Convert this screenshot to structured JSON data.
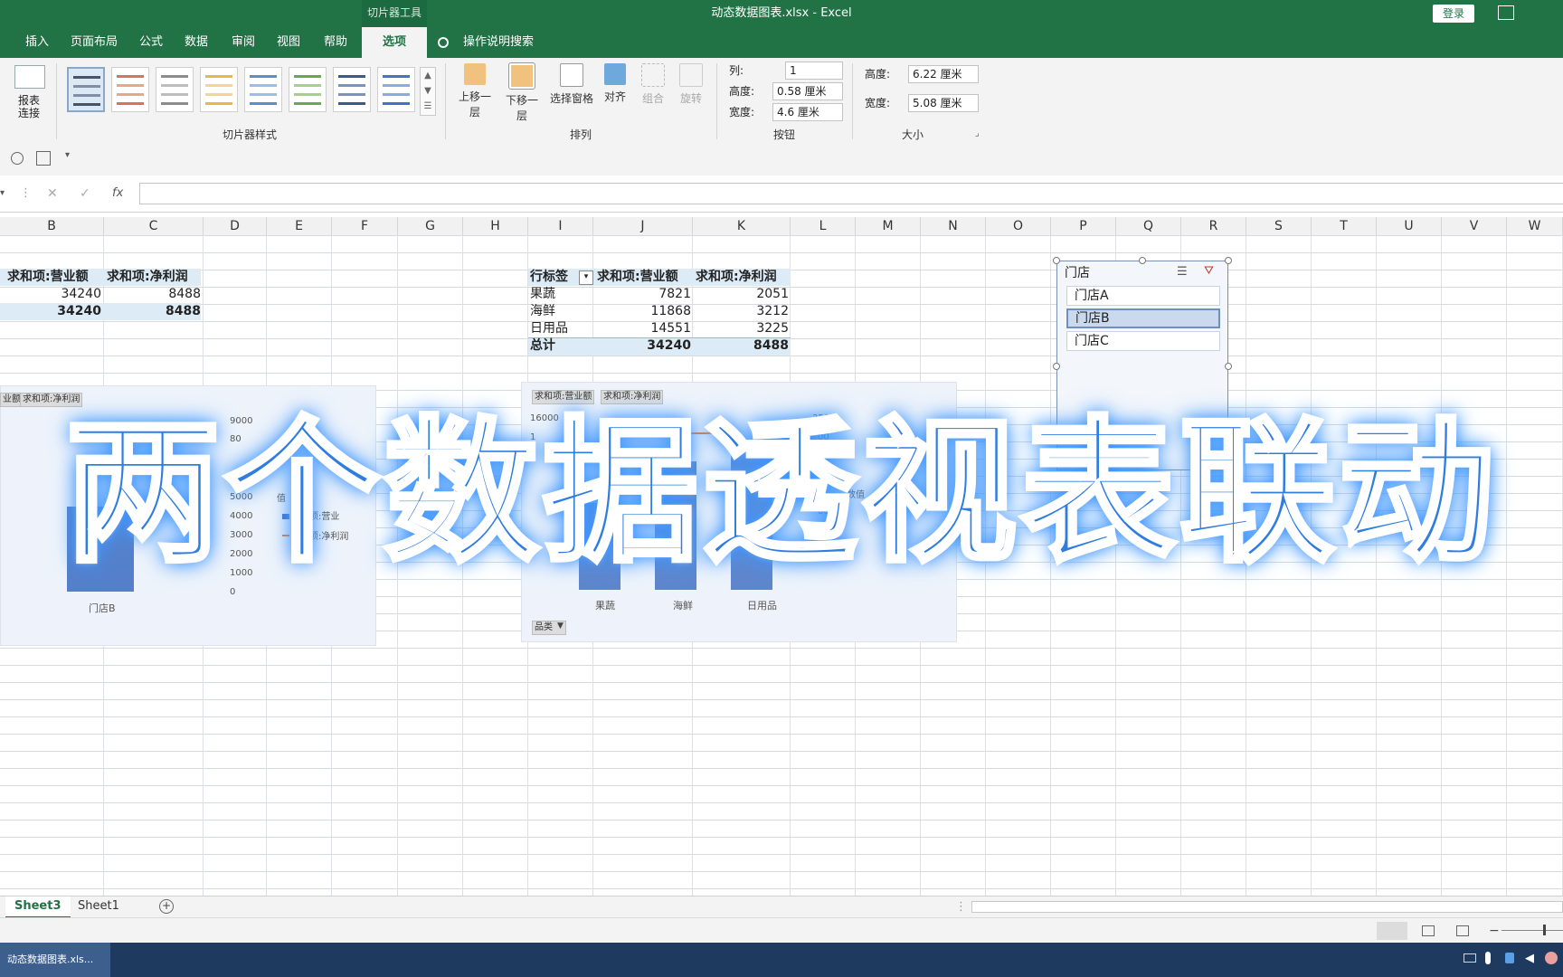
{
  "window": {
    "context_tab_group": "切片器工具",
    "title": "动态数据图表.xlsx  -  Excel",
    "login_label": "登录"
  },
  "tabs": [
    {
      "label": "插入"
    },
    {
      "label": "页面布局"
    },
    {
      "label": "公式"
    },
    {
      "label": "数据"
    },
    {
      "label": "审阅"
    },
    {
      "label": "视图"
    },
    {
      "label": "帮助"
    },
    {
      "label": "选项",
      "active": true
    }
  ],
  "tell_me": "操作说明搜索",
  "ribbon": {
    "report_connections": "报表\n连接",
    "slicer_styles_label": "切片器样式",
    "arrange": {
      "label": "排列",
      "buttons": [
        "上移一层",
        "下移一层",
        "选择窗格",
        "对齐",
        "组合",
        "旋转"
      ]
    },
    "buttons_group": {
      "label": "按钮",
      "columns_label": "列:",
      "columns_value": "1",
      "height_label": "高度:",
      "height_value": "0.58 厘米",
      "width_label": "宽度:",
      "width_value": "4.6 厘米"
    },
    "size_group": {
      "label": "大小",
      "height_label": "高度:",
      "height_value": "6.22 厘米",
      "width_label": "宽度:",
      "width_value": "5.08 厘米"
    }
  },
  "formula_bar": {
    "cancel": "✕",
    "enter": "✓",
    "fx": "fx"
  },
  "columns": [
    "B",
    "C",
    "D",
    "E",
    "F",
    "G",
    "H",
    "I",
    "J",
    "K",
    "L",
    "M",
    "N",
    "O",
    "P",
    "Q",
    "R",
    "S",
    "T",
    "U",
    "V",
    "W"
  ],
  "pivot1": {
    "header": [
      "求和项:营业额",
      "求和项:净利润"
    ],
    "row1": [
      "34240",
      "8488"
    ],
    "total": [
      "34240",
      "8488"
    ]
  },
  "pivot2": {
    "header": [
      "行标签",
      "求和项:营业额",
      "求和项:净利润"
    ],
    "rows": [
      [
        "果蔬",
        "7821",
        "2051"
      ],
      [
        "海鲜",
        "11868",
        "3212"
      ],
      [
        "日用品",
        "14551",
        "3225"
      ]
    ],
    "total": [
      "总计",
      "34240",
      "8488"
    ]
  },
  "chart1": {
    "chips": [
      "业额",
      "求和项:净利润"
    ],
    "y_ticks": [
      "9000",
      "80",
      "5000",
      "4000",
      "3000",
      "2000",
      "1000",
      "0"
    ],
    "legend_title": "值",
    "legend": [
      "求和项:营业",
      "求和项:净利润"
    ],
    "category": "门店B"
  },
  "chart2": {
    "chips": [
      "求和项:营业额",
      "求和项:净利润"
    ],
    "y_left": [
      "16000",
      "1"
    ],
    "y_right": [
      "3500",
      "00",
      "00"
    ],
    "legend_title": "数值",
    "categories": [
      "果蔬",
      "海鲜",
      "日用品"
    ],
    "field_button": "品类"
  },
  "slicer": {
    "title": "门店",
    "items": [
      {
        "label": "门店A",
        "selected": false
      },
      {
        "label": "门店B",
        "selected": true
      },
      {
        "label": "门店C",
        "selected": false
      }
    ]
  },
  "sheets": [
    {
      "label": "Sheet3",
      "active": true
    },
    {
      "label": "Sheet1",
      "active": false
    }
  ],
  "taskbar": {
    "excel_item": "动态数据图表.xls..."
  },
  "overlay_title": "两个数据透视表联动",
  "colors": {
    "excel_green": "#217346",
    "overlay_blue": "#2f7de1",
    "pivot_header_fill": "#ddebf7"
  }
}
